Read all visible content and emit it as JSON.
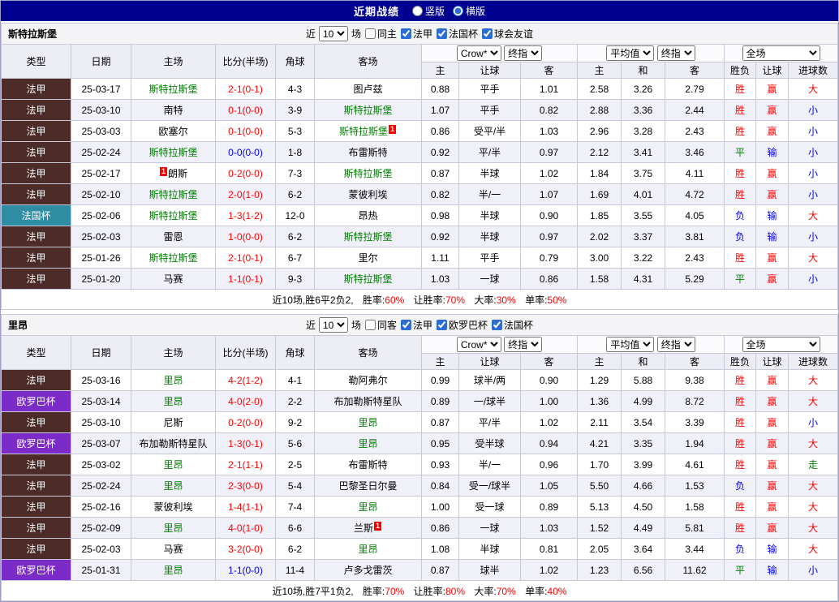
{
  "topbar": {
    "title": "近期战绩",
    "options": [
      {
        "label": "竖版",
        "checked": false
      },
      {
        "label": "横版",
        "checked": true
      }
    ]
  },
  "labels": {
    "near": "近",
    "games": "场"
  },
  "table": {
    "cols": {
      "type": "类型",
      "date": "日期",
      "home": "主场",
      "score": "比分(半场)",
      "corner": "角球",
      "away": "客场"
    },
    "selects": {
      "company": "Crow*",
      "final": "终指",
      "avg": "平均值",
      "scope": "全场"
    },
    "sub": [
      "主",
      "让球",
      "客",
      "主",
      "和",
      "客",
      "胜负",
      "让球",
      "进球数"
    ]
  },
  "league_colors": {
    "法甲": "#4C2B28",
    "法国杯": "#2F8DA3",
    "欧罗巴杯": "#7B2BC8"
  },
  "result_colors": {
    "red": "#ff0000",
    "blue": "#0000ff",
    "green": "#008000",
    "black": "#000000"
  },
  "sections": [
    {
      "team": "斯特拉斯堡",
      "filter": {
        "count": "10",
        "same": "同主",
        "same_checked": false,
        "leagues": [
          "法甲",
          "法国杯",
          "球会友谊"
        ]
      },
      "rows": [
        {
          "league": "法甲",
          "date": "25-03-17",
          "home": "斯特拉斯堡",
          "home_green": true,
          "away": "图卢兹",
          "score": "2-1(0-1)",
          "score_color": "red",
          "corner": "4-3",
          "odds": [
            "0.88",
            "平手",
            "1.01",
            "2.58",
            "3.26",
            "2.79"
          ],
          "res": [
            "胜",
            "赢",
            "大"
          ],
          "res_colors": [
            "red",
            "red",
            "red"
          ]
        },
        {
          "league": "法甲",
          "date": "25-03-10",
          "home": "南特",
          "away": "斯特拉斯堡",
          "away_green": true,
          "score": "0-1(0-0)",
          "score_color": "red",
          "corner": "3-9",
          "odds": [
            "1.07",
            "平手",
            "0.82",
            "2.88",
            "3.36",
            "2.44"
          ],
          "res": [
            "胜",
            "赢",
            "小"
          ],
          "res_colors": [
            "red",
            "red",
            "blue"
          ]
        },
        {
          "league": "法甲",
          "date": "25-03-03",
          "home": "欧塞尔",
          "away": "斯特拉斯堡",
          "away_green": true,
          "away_badge_after": "1",
          "score": "0-1(0-0)",
          "score_color": "red",
          "corner": "5-3",
          "odds": [
            "0.86",
            "受平/半",
            "1.03",
            "2.96",
            "3.28",
            "2.43"
          ],
          "res": [
            "胜",
            "赢",
            "小"
          ],
          "res_colors": [
            "red",
            "red",
            "blue"
          ]
        },
        {
          "league": "法甲",
          "date": "25-02-24",
          "home": "斯特拉斯堡",
          "home_green": true,
          "away": "布雷斯特",
          "score": "0-0(0-0)",
          "score_color": "blue",
          "corner": "1-8",
          "odds": [
            "0.92",
            "平/半",
            "0.97",
            "2.12",
            "3.41",
            "3.46"
          ],
          "res": [
            "平",
            "输",
            "小"
          ],
          "res_colors": [
            "green",
            "blue",
            "blue"
          ]
        },
        {
          "league": "法甲",
          "date": "25-02-17",
          "home": "朗斯",
          "home_badge_before": "1",
          "away": "斯特拉斯堡",
          "away_green": true,
          "score": "0-2(0-0)",
          "score_color": "red",
          "corner": "7-3",
          "odds": [
            "0.87",
            "半球",
            "1.02",
            "1.84",
            "3.75",
            "4.11"
          ],
          "res": [
            "胜",
            "赢",
            "小"
          ],
          "res_colors": [
            "red",
            "red",
            "blue"
          ]
        },
        {
          "league": "法甲",
          "date": "25-02-10",
          "home": "斯特拉斯堡",
          "home_green": true,
          "away": "蒙彼利埃",
          "score": "2-0(1-0)",
          "score_color": "red",
          "corner": "6-2",
          "odds": [
            "0.82",
            "半/一",
            "1.07",
            "1.69",
            "4.01",
            "4.72"
          ],
          "res": [
            "胜",
            "赢",
            "小"
          ],
          "res_colors": [
            "red",
            "red",
            "blue"
          ]
        },
        {
          "league": "法国杯",
          "date": "25-02-06",
          "home": "斯特拉斯堡",
          "home_green": true,
          "away": "昂热",
          "score": "1-3(1-2)",
          "score_color": "red",
          "corner": "12-0",
          "odds": [
            "0.98",
            "半球",
            "0.90",
            "1.85",
            "3.55",
            "4.05"
          ],
          "res": [
            "负",
            "输",
            "大"
          ],
          "res_colors": [
            "blue",
            "blue",
            "red"
          ]
        },
        {
          "league": "法甲",
          "date": "25-02-03",
          "home": "雷恩",
          "away": "斯特拉斯堡",
          "away_green": true,
          "score": "1-0(0-0)",
          "score_color": "red",
          "corner": "6-2",
          "odds": [
            "0.92",
            "半球",
            "0.97",
            "2.02",
            "3.37",
            "3.81"
          ],
          "res": [
            "负",
            "输",
            "小"
          ],
          "res_colors": [
            "blue",
            "blue",
            "blue"
          ]
        },
        {
          "league": "法甲",
          "date": "25-01-26",
          "home": "斯特拉斯堡",
          "home_green": true,
          "away": "里尔",
          "score": "2-1(0-1)",
          "score_color": "red",
          "corner": "6-7",
          "odds": [
            "1.11",
            "平手",
            "0.79",
            "3.00",
            "3.22",
            "2.43"
          ],
          "res": [
            "胜",
            "赢",
            "大"
          ],
          "res_colors": [
            "red",
            "red",
            "red"
          ]
        },
        {
          "league": "法甲",
          "date": "25-01-20",
          "home": "马赛",
          "away": "斯特拉斯堡",
          "away_green": true,
          "score": "1-1(0-1)",
          "score_color": "red",
          "corner": "9-3",
          "odds": [
            "1.03",
            "一球",
            "0.86",
            "1.58",
            "4.31",
            "5.29"
          ],
          "res": [
            "平",
            "赢",
            "小"
          ],
          "res_colors": [
            "green",
            "red",
            "blue"
          ]
        }
      ],
      "summary": {
        "prefix": "近10场,胜6平2负2, ",
        "stats": [
          {
            "label": "胜率:",
            "value": "60%"
          },
          {
            "label": "让胜率:",
            "value": "70%"
          },
          {
            "label": "大率:",
            "value": "30%"
          },
          {
            "label": "单率:",
            "value": "50%"
          }
        ]
      }
    },
    {
      "team": "里昂",
      "filter": {
        "count": "10",
        "same": "同客",
        "same_checked": false,
        "leagues": [
          "法甲",
          "欧罗巴杯",
          "法国杯"
        ]
      },
      "rows": [
        {
          "league": "法甲",
          "date": "25-03-16",
          "home": "里昂",
          "home_green": true,
          "away": "勒阿弗尔",
          "score": "4-2(1-2)",
          "score_color": "red",
          "corner": "4-1",
          "odds": [
            "0.99",
            "球半/两",
            "0.90",
            "1.29",
            "5.88",
            "9.38"
          ],
          "res": [
            "胜",
            "赢",
            "大"
          ],
          "res_colors": [
            "red",
            "red",
            "red"
          ]
        },
        {
          "league": "欧罗巴杯",
          "date": "25-03-14",
          "home": "里昂",
          "home_green": true,
          "away": "布加勒斯特星队",
          "score": "4-0(2-0)",
          "score_color": "red",
          "corner": "2-2",
          "odds": [
            "0.89",
            "一/球半",
            "1.00",
            "1.36",
            "4.99",
            "8.72"
          ],
          "res": [
            "胜",
            "赢",
            "大"
          ],
          "res_colors": [
            "red",
            "red",
            "red"
          ]
        },
        {
          "league": "法甲",
          "date": "25-03-10",
          "home": "尼斯",
          "away": "里昂",
          "away_green": true,
          "score": "0-2(0-0)",
          "score_color": "red",
          "corner": "9-2",
          "odds": [
            "0.87",
            "平/半",
            "1.02",
            "2.11",
            "3.54",
            "3.39"
          ],
          "res": [
            "胜",
            "赢",
            "小"
          ],
          "res_colors": [
            "red",
            "red",
            "blue"
          ]
        },
        {
          "league": "欧罗巴杯",
          "date": "25-03-07",
          "home": "布加勒斯特星队",
          "away": "里昂",
          "away_green": true,
          "score": "1-3(0-1)",
          "score_color": "red",
          "corner": "5-6",
          "odds": [
            "0.95",
            "受半球",
            "0.94",
            "4.21",
            "3.35",
            "1.94"
          ],
          "res": [
            "胜",
            "赢",
            "大"
          ],
          "res_colors": [
            "red",
            "red",
            "red"
          ]
        },
        {
          "league": "法甲",
          "date": "25-03-02",
          "home": "里昂",
          "home_green": true,
          "away": "布雷斯特",
          "score": "2-1(1-1)",
          "score_color": "red",
          "corner": "2-5",
          "odds": [
            "0.93",
            "半/一",
            "0.96",
            "1.70",
            "3.99",
            "4.61"
          ],
          "res": [
            "胜",
            "赢",
            "走"
          ],
          "res_colors": [
            "red",
            "red",
            "green"
          ]
        },
        {
          "league": "法甲",
          "date": "25-02-24",
          "home": "里昂",
          "home_green": true,
          "away": "巴黎圣日尔曼",
          "score": "2-3(0-0)",
          "score_color": "red",
          "corner": "5-4",
          "odds": [
            "0.84",
            "受一/球半",
            "1.05",
            "5.50",
            "4.66",
            "1.53"
          ],
          "res": [
            "负",
            "赢",
            "大"
          ],
          "res_colors": [
            "blue",
            "red",
            "red"
          ]
        },
        {
          "league": "法甲",
          "date": "25-02-16",
          "home": "蒙彼利埃",
          "away": "里昂",
          "away_green": true,
          "score": "1-4(1-1)",
          "score_color": "red",
          "corner": "7-4",
          "odds": [
            "1.00",
            "受一球",
            "0.89",
            "5.13",
            "4.50",
            "1.58"
          ],
          "res": [
            "胜",
            "赢",
            "大"
          ],
          "res_colors": [
            "red",
            "red",
            "red"
          ]
        },
        {
          "league": "法甲",
          "date": "25-02-09",
          "home": "里昂",
          "home_green": true,
          "away": "兰斯",
          "away_badge_after": "1",
          "score": "4-0(1-0)",
          "score_color": "red",
          "corner": "6-6",
          "odds": [
            "0.86",
            "一球",
            "1.03",
            "1.52",
            "4.49",
            "5.81"
          ],
          "res": [
            "胜",
            "赢",
            "大"
          ],
          "res_colors": [
            "red",
            "red",
            "red"
          ]
        },
        {
          "league": "法甲",
          "date": "25-02-03",
          "home": "马赛",
          "away": "里昂",
          "away_green": true,
          "score": "3-2(0-0)",
          "score_color": "red",
          "corner": "6-2",
          "odds": [
            "1.08",
            "半球",
            "0.81",
            "2.05",
            "3.64",
            "3.44"
          ],
          "res": [
            "负",
            "输",
            "大"
          ],
          "res_colors": [
            "blue",
            "blue",
            "red"
          ]
        },
        {
          "league": "欧罗巴杯",
          "date": "25-01-31",
          "home": "里昂",
          "home_green": true,
          "away": "卢多戈雷茨",
          "score": "1-1(0-0)",
          "score_color": "blue",
          "corner": "11-4",
          "odds": [
            "0.87",
            "球半",
            "1.02",
            "1.23",
            "6.56",
            "11.62"
          ],
          "res": [
            "平",
            "输",
            "小"
          ],
          "res_colors": [
            "green",
            "blue",
            "blue"
          ]
        }
      ],
      "summary": {
        "prefix": "近10场,胜7平1负2, ",
        "stats": [
          {
            "label": "胜率:",
            "value": "70%"
          },
          {
            "label": "让胜率:",
            "value": "80%"
          },
          {
            "label": "大率:",
            "value": "70%"
          },
          {
            "label": "单率:",
            "value": "40%"
          }
        ]
      }
    }
  ]
}
